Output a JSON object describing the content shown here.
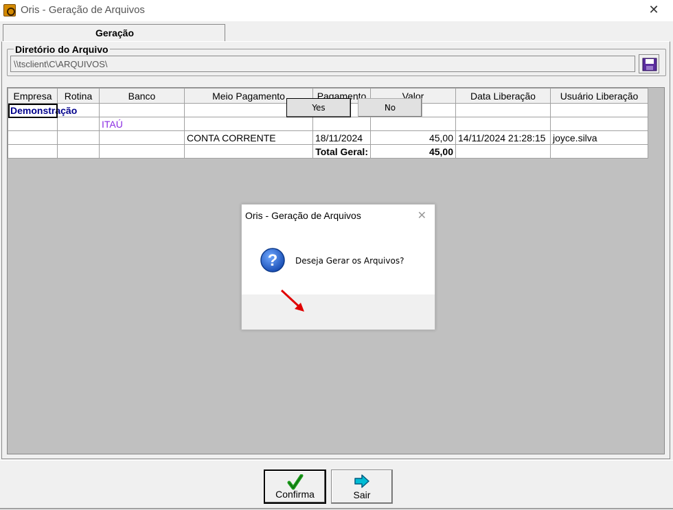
{
  "window": {
    "title": "Oris - Geração de Arquivos"
  },
  "tabs": [
    {
      "label": "Geração"
    }
  ],
  "directory": {
    "group_label": "Diretório do Arquivo",
    "value": "\\\\tsclient\\C\\ARQUIVOS\\"
  },
  "grid": {
    "columns": [
      "Empresa",
      "Rotina",
      "Banco",
      "Meio Pagamento",
      "Pagamento",
      "Valor",
      "Data Liberação",
      "Usuário Liberação"
    ],
    "company": "Demonstração",
    "bank": "ITAÚ",
    "row": {
      "meio_pagamento": "CONTA CORRENTE",
      "pagamento": "18/11/2024",
      "valor": "45,00",
      "data_liberacao": "14/11/2024 21:28:15",
      "usuario_liberacao": "joyce.silva"
    },
    "total_label": "Total Geral:",
    "total_value": "45,00"
  },
  "dialog": {
    "title": "Oris - Geração de Arquivos",
    "message": "Deseja Gerar os Arquivos?",
    "yes_label": "Yes",
    "no_label": "No"
  },
  "footer": {
    "confirm_label": "Confirma",
    "exit_label": "Sair"
  },
  "colors": {
    "company_text": "#00008b",
    "bank_text": "#8a2be2",
    "annotation_arrow": "#e00000",
    "confirm_icon": "#1a9a1a",
    "exit_icon": "#00bcd4"
  }
}
